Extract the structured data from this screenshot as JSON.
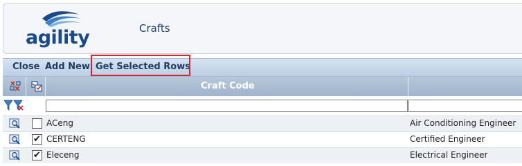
{
  "header": {
    "brand": "agility",
    "page_title": "Crafts"
  },
  "toolbar": {
    "close_label": "Close",
    "add_new_label": "Add New",
    "get_selected_label": "Get Selected Rows",
    "highlight_color": "#d3262f"
  },
  "grid": {
    "columns": {
      "select_all_icon": "select-all-icon",
      "toggle_icon": "toggle-select-icon",
      "craft_code_label": "Craft Code"
    },
    "filter": {
      "filter_icon": "filter-icon",
      "clear_filter_icon": "clear-filter-icon",
      "craft_code_value": "",
      "description_value": ""
    },
    "rows": [
      {
        "code": "ACeng",
        "description": "Air Conditioning Engineer",
        "checked": false
      },
      {
        "code": "CERTENG",
        "description": "Certified Engineer",
        "checked": true
      },
      {
        "code": "Eleceng",
        "description": "Electrical Engineer",
        "checked": true
      }
    ]
  },
  "colors": {
    "brand_blue": "#1a4a8a",
    "header_bg": "#9fb3ca",
    "toolbar_bg": "#c8d8eb"
  }
}
